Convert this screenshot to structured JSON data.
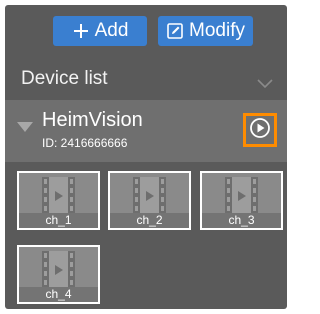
{
  "toolbar": {
    "add_label": "Add",
    "modify_label": "Modify",
    "add_icon": "plus-icon",
    "modify_icon": "edit-icon"
  },
  "device_list": {
    "title": "Device list",
    "chevron_icon": "chevron-down-icon"
  },
  "device": {
    "name": "HeimVision",
    "id_text": "ID: 2416666666",
    "play_icon": "play-circle-icon",
    "highlight_color": "#ff8c00"
  },
  "channels": [
    {
      "label": "ch_1"
    },
    {
      "label": "ch_2"
    },
    {
      "label": "ch_3"
    },
    {
      "label": "ch_4"
    }
  ],
  "colors": {
    "accent": "#3a7fd0",
    "panel": "#5a5a5a",
    "device_row": "#6f6f6f"
  }
}
